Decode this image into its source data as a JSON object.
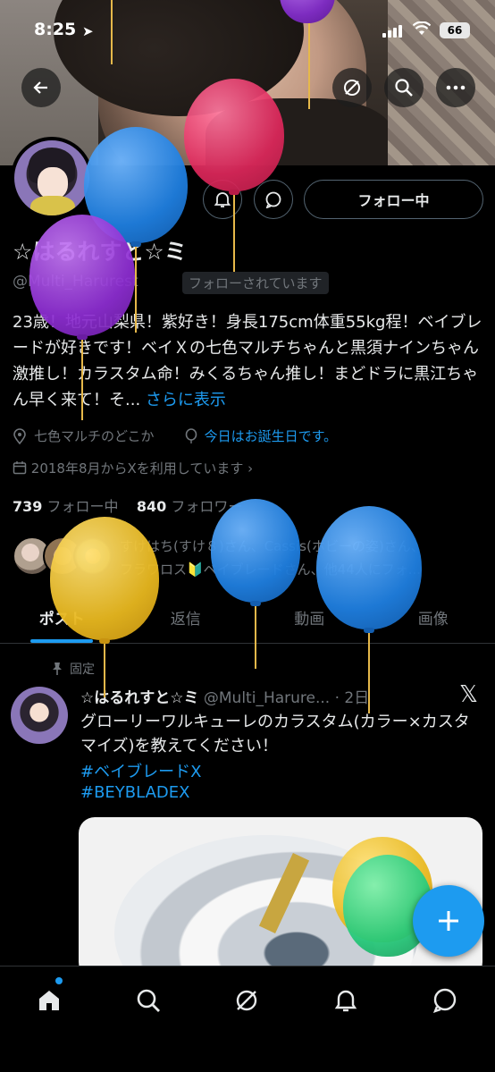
{
  "status_bar": {
    "time": "8:25",
    "battery": "66"
  },
  "profile": {
    "display_name": "☆はるれすと☆ミ",
    "handle": "@Multi_Harurest",
    "follows_you_badge": "フォローされています",
    "follow_button_label": "フォロー中",
    "bio": "23歳！地元山梨県！紫好き！身長175cm体重55kg程！ベイブレードが好きです！ベイＸの七色マルチちゃんと黒須ナインちゃん激推し！カラスタム命！みくるちゃん推し！まどドラに黒江ちゃん早く来て！そ...",
    "bio_more": "さらに表示",
    "location": "七色マルチのどこか",
    "birthday": "今日はお誕生日です。",
    "joined": "2018年8月からXを利用しています",
    "following_count": "739",
    "following_label": "フォロー中",
    "followers_count": "840",
    "followers_label": "フォロワー",
    "followed_by_line1": "すけはち(すけ８)さん、Cassis(ホビーの姿)さん、",
    "followed_by_line2": "フラワロス🔰ベイブレードさん、他44人にフォ..."
  },
  "tabs": [
    {
      "label": "ポスト",
      "active": true
    },
    {
      "label": "返信",
      "active": false
    },
    {
      "label": "動画",
      "active": false
    },
    {
      "label": "画像",
      "active": false
    }
  ],
  "post": {
    "pinned_label": "固定",
    "author_name": "☆はるれすと☆ミ",
    "author_handle": "@Multi_Harure...",
    "time": "· 2日",
    "text": "グローリーワルキューレのカラスタム(カラー×カスタマイズ)を教えてください！",
    "hashtag1": "#ベイブレードX",
    "hashtag2": "#BEYBLADEX"
  },
  "icons": {
    "back": "back-arrow-icon",
    "grok": "grok-icon",
    "search": "search-icon",
    "more": "more-icon",
    "notify": "bell-plus-icon",
    "message": "message-icon",
    "location": "location-pin-icon",
    "birthday": "balloon-icon",
    "calendar": "calendar-icon",
    "fab": "compose-plus-icon",
    "nav_home": "home-icon",
    "nav_search": "search-icon",
    "nav_grok": "grok-icon",
    "nav_notifications": "bell-icon",
    "nav_messages": "message-icon"
  },
  "colors": {
    "accent": "#1d9bf0",
    "background": "#000000",
    "muted": "#71767b"
  }
}
